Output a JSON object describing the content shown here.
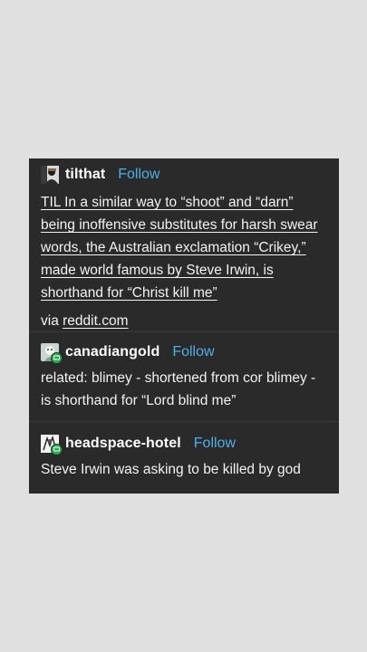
{
  "posts": [
    {
      "username": "tilthat",
      "follow_label": "Follow",
      "avatar_icon": "black-and-white-portrait-avatar",
      "title_link": "TIL In a similar way to “shoot” and “darn” being inoffensive substitutes for harsh swear words, the Australian exclamation “Crikey,” made world famous by Steve Irwin, is shorthand for “Christ kill me”",
      "via_label": "via",
      "via_link": "reddit.com"
    },
    {
      "username": "canadiangold",
      "follow_label": "Follow",
      "avatar_icon": "cartoon-avatar",
      "body": "related: blimey - shortened from cor blimey - is shorthand for “Lord blind me”"
    },
    {
      "username": "headspace-hotel",
      "follow_label": "Follow",
      "avatar_icon": "sketch-avatar",
      "body": "Steve Irwin was asking to be killed by god"
    }
  ],
  "colors": {
    "page_bg": "#e0e0e0",
    "card_bg": "#2a2a2a",
    "follow": "#4ab0e8",
    "online_badge": "#22b14c"
  }
}
